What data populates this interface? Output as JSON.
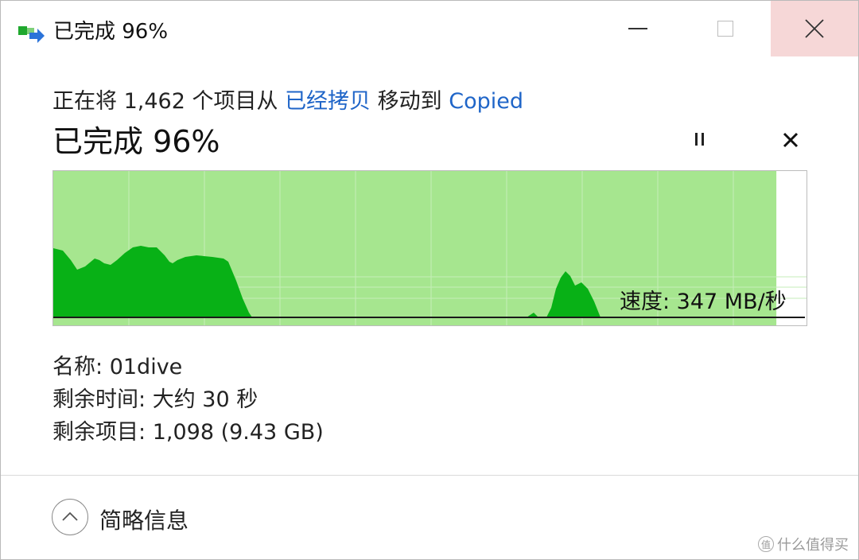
{
  "window": {
    "title": "已完成 96%"
  },
  "header": {
    "from_prefix": "正在将 1,462 个项目从",
    "source": "已经拷贝",
    "move_to": "移动到",
    "destination": "Copied",
    "progress_title": "已完成 96%"
  },
  "graph": {
    "progress_fraction": 0.96,
    "speed_label": "速度: 347 MB/秒"
  },
  "details": {
    "name_label": "名称:",
    "name_value": "01dive",
    "time_label": "剩余时间:",
    "time_value": "大约 30 秒",
    "items_label": "剩余项目:",
    "items_value": "1,098 (9.43 GB)"
  },
  "footer": {
    "less_details": "简略信息"
  },
  "watermark": {
    "logo_text": "值",
    "text": "什么值得买"
  },
  "colors": {
    "progress_fill": "#a6e68f",
    "speed_fill": "#08b116",
    "link": "#1f65c8",
    "close_hover": "#f6d7d7"
  },
  "icons": {
    "app": "file-move-icon",
    "pause": "pause-icon",
    "cancel": "close-icon",
    "collapse": "chevron-up-icon"
  }
}
